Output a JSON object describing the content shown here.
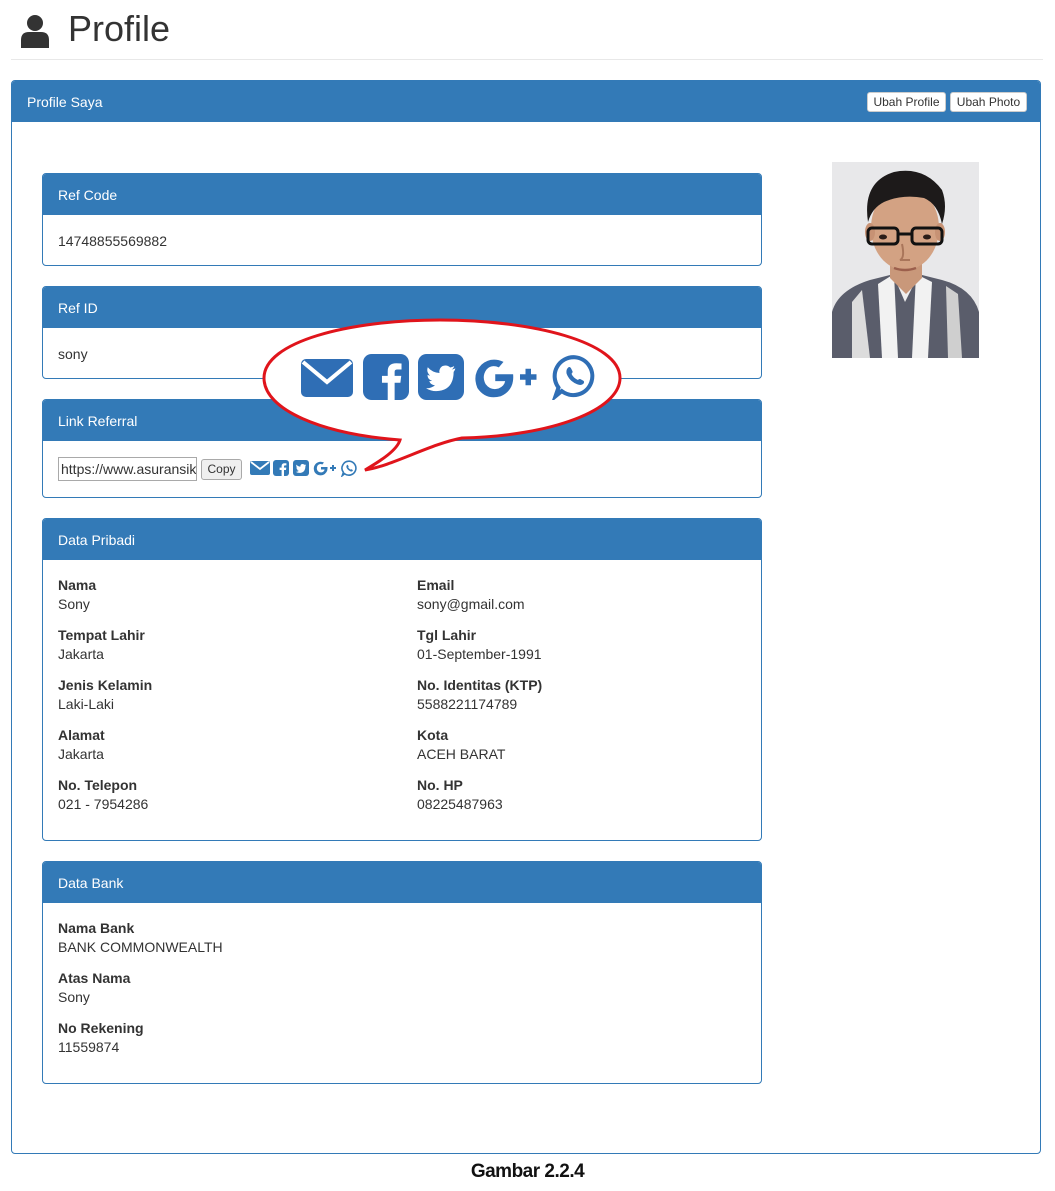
{
  "page": {
    "title": "Profile"
  },
  "main_panel": {
    "title": "Profile Saya",
    "buttons": {
      "edit_profile": "Ubah Profile",
      "edit_photo": "Ubah Photo"
    }
  },
  "ref_code": {
    "title": "Ref Code",
    "value": "14748855569882"
  },
  "ref_id": {
    "title": "Ref ID",
    "value": "sony"
  },
  "link_referral": {
    "title": "Link Referral",
    "input_value": "https://www.asuransikita",
    "copy_label": "Copy",
    "share_icons": [
      "envelope-icon",
      "facebook-icon",
      "twitter-icon",
      "google-plus-icon",
      "whatsapp-icon"
    ]
  },
  "data_pribadi": {
    "title": "Data Pribadi",
    "fields": [
      {
        "label": "Nama",
        "value": "Sony"
      },
      {
        "label": "Email",
        "value": "sony@gmail.com"
      },
      {
        "label": "Tempat Lahir",
        "value": "Jakarta"
      },
      {
        "label": "Tgl Lahir",
        "value": "01-September-1991"
      },
      {
        "label": "Jenis Kelamin",
        "value": "Laki-Laki"
      },
      {
        "label": "No. Identitas (KTP)",
        "value": "5588221174789"
      },
      {
        "label": "Alamat",
        "value": "Jakarta"
      },
      {
        "label": "Kota",
        "value": "ACEH BARAT"
      },
      {
        "label": "No. Telepon",
        "value": "021 - 7954286"
      },
      {
        "label": "No. HP",
        "value": "08225487963"
      }
    ]
  },
  "data_bank": {
    "title": "Data Bank",
    "fields": [
      {
        "label": "Nama Bank",
        "value": "BANK COMMONWEALTH"
      },
      {
        "label": "Atas Nama",
        "value": "Sony"
      },
      {
        "label": "No Rekening",
        "value": "11559874"
      }
    ]
  },
  "callout": {
    "icons": [
      "envelope-icon",
      "facebook-icon",
      "twitter-icon",
      "google-plus-icon",
      "whatsapp-icon"
    ],
    "color": "#2f6eb5",
    "outline_color": "#e0141b"
  },
  "caption": "Gambar 2.2.4",
  "colors": {
    "primary": "#337ab7"
  }
}
